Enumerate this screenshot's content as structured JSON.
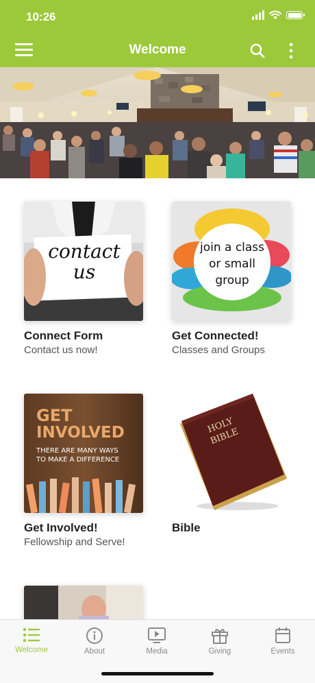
{
  "status_bar": {
    "time": "10:26"
  },
  "app_bar": {
    "title": "Welcome",
    "menu_icon": "hamburger-menu-icon",
    "search_icon": "search-icon",
    "more_icon": "more-vertical-icon"
  },
  "hero": {
    "image": "church-congregation-photo"
  },
  "cards": [
    {
      "title": "Connect Form",
      "subtitle": "Contact us now!",
      "image_text": [
        "contact",
        "us"
      ]
    },
    {
      "title": "Get Connected!",
      "subtitle": "Classes and Groups",
      "image_text": [
        "join a class",
        "or small",
        "group"
      ]
    },
    {
      "title": "Get Involved!",
      "subtitle": "Fellowship and Serve!",
      "image_text": [
        "GET",
        "INVOLVED",
        "THERE ARE MANY WAYS",
        "TO MAKE A DIFFERENCE"
      ]
    },
    {
      "title": "Bible",
      "subtitle": "",
      "image_text": [
        "HOLY",
        "BIBLE"
      ]
    },
    {
      "title": "",
      "subtitle": "",
      "image_text": []
    }
  ],
  "tabs": [
    {
      "label": "Welcome",
      "icon": "list-icon",
      "active": true
    },
    {
      "label": "About",
      "icon": "info-icon",
      "active": false
    },
    {
      "label": "Media",
      "icon": "play-screen-icon",
      "active": false
    },
    {
      "label": "Giving",
      "icon": "gift-icon",
      "active": false
    },
    {
      "label": "Events",
      "icon": "calendar-icon",
      "active": false
    }
  ],
  "colors": {
    "brand": "#9cc93a",
    "tab_inactive": "#8a8a8a"
  }
}
